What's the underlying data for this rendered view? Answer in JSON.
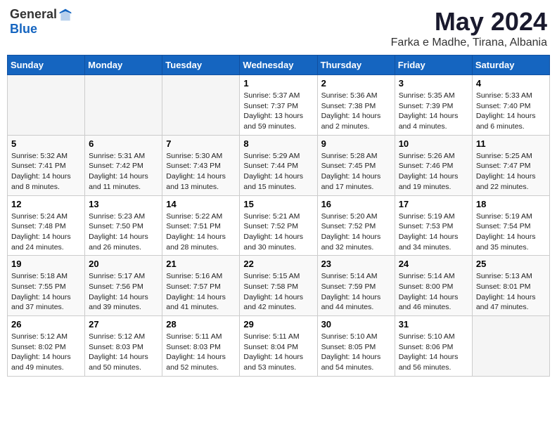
{
  "header": {
    "logo_general": "General",
    "logo_blue": "Blue",
    "title": "May 2024",
    "subtitle": "Farka e Madhe, Tirana, Albania"
  },
  "weekdays": [
    "Sunday",
    "Monday",
    "Tuesday",
    "Wednesday",
    "Thursday",
    "Friday",
    "Saturday"
  ],
  "weeks": [
    [
      {
        "day": "",
        "info": ""
      },
      {
        "day": "",
        "info": ""
      },
      {
        "day": "",
        "info": ""
      },
      {
        "day": "1",
        "info": "Sunrise: 5:37 AM\nSunset: 7:37 PM\nDaylight: 13 hours\nand 59 minutes."
      },
      {
        "day": "2",
        "info": "Sunrise: 5:36 AM\nSunset: 7:38 PM\nDaylight: 14 hours\nand 2 minutes."
      },
      {
        "day": "3",
        "info": "Sunrise: 5:35 AM\nSunset: 7:39 PM\nDaylight: 14 hours\nand 4 minutes."
      },
      {
        "day": "4",
        "info": "Sunrise: 5:33 AM\nSunset: 7:40 PM\nDaylight: 14 hours\nand 6 minutes."
      }
    ],
    [
      {
        "day": "5",
        "info": "Sunrise: 5:32 AM\nSunset: 7:41 PM\nDaylight: 14 hours\nand 8 minutes."
      },
      {
        "day": "6",
        "info": "Sunrise: 5:31 AM\nSunset: 7:42 PM\nDaylight: 14 hours\nand 11 minutes."
      },
      {
        "day": "7",
        "info": "Sunrise: 5:30 AM\nSunset: 7:43 PM\nDaylight: 14 hours\nand 13 minutes."
      },
      {
        "day": "8",
        "info": "Sunrise: 5:29 AM\nSunset: 7:44 PM\nDaylight: 14 hours\nand 15 minutes."
      },
      {
        "day": "9",
        "info": "Sunrise: 5:28 AM\nSunset: 7:45 PM\nDaylight: 14 hours\nand 17 minutes."
      },
      {
        "day": "10",
        "info": "Sunrise: 5:26 AM\nSunset: 7:46 PM\nDaylight: 14 hours\nand 19 minutes."
      },
      {
        "day": "11",
        "info": "Sunrise: 5:25 AM\nSunset: 7:47 PM\nDaylight: 14 hours\nand 22 minutes."
      }
    ],
    [
      {
        "day": "12",
        "info": "Sunrise: 5:24 AM\nSunset: 7:48 PM\nDaylight: 14 hours\nand 24 minutes."
      },
      {
        "day": "13",
        "info": "Sunrise: 5:23 AM\nSunset: 7:50 PM\nDaylight: 14 hours\nand 26 minutes."
      },
      {
        "day": "14",
        "info": "Sunrise: 5:22 AM\nSunset: 7:51 PM\nDaylight: 14 hours\nand 28 minutes."
      },
      {
        "day": "15",
        "info": "Sunrise: 5:21 AM\nSunset: 7:52 PM\nDaylight: 14 hours\nand 30 minutes."
      },
      {
        "day": "16",
        "info": "Sunrise: 5:20 AM\nSunset: 7:52 PM\nDaylight: 14 hours\nand 32 minutes."
      },
      {
        "day": "17",
        "info": "Sunrise: 5:19 AM\nSunset: 7:53 PM\nDaylight: 14 hours\nand 34 minutes."
      },
      {
        "day": "18",
        "info": "Sunrise: 5:19 AM\nSunset: 7:54 PM\nDaylight: 14 hours\nand 35 minutes."
      }
    ],
    [
      {
        "day": "19",
        "info": "Sunrise: 5:18 AM\nSunset: 7:55 PM\nDaylight: 14 hours\nand 37 minutes."
      },
      {
        "day": "20",
        "info": "Sunrise: 5:17 AM\nSunset: 7:56 PM\nDaylight: 14 hours\nand 39 minutes."
      },
      {
        "day": "21",
        "info": "Sunrise: 5:16 AM\nSunset: 7:57 PM\nDaylight: 14 hours\nand 41 minutes."
      },
      {
        "day": "22",
        "info": "Sunrise: 5:15 AM\nSunset: 7:58 PM\nDaylight: 14 hours\nand 42 minutes."
      },
      {
        "day": "23",
        "info": "Sunrise: 5:14 AM\nSunset: 7:59 PM\nDaylight: 14 hours\nand 44 minutes."
      },
      {
        "day": "24",
        "info": "Sunrise: 5:14 AM\nSunset: 8:00 PM\nDaylight: 14 hours\nand 46 minutes."
      },
      {
        "day": "25",
        "info": "Sunrise: 5:13 AM\nSunset: 8:01 PM\nDaylight: 14 hours\nand 47 minutes."
      }
    ],
    [
      {
        "day": "26",
        "info": "Sunrise: 5:12 AM\nSunset: 8:02 PM\nDaylight: 14 hours\nand 49 minutes."
      },
      {
        "day": "27",
        "info": "Sunrise: 5:12 AM\nSunset: 8:03 PM\nDaylight: 14 hours\nand 50 minutes."
      },
      {
        "day": "28",
        "info": "Sunrise: 5:11 AM\nSunset: 8:03 PM\nDaylight: 14 hours\nand 52 minutes."
      },
      {
        "day": "29",
        "info": "Sunrise: 5:11 AM\nSunset: 8:04 PM\nDaylight: 14 hours\nand 53 minutes."
      },
      {
        "day": "30",
        "info": "Sunrise: 5:10 AM\nSunset: 8:05 PM\nDaylight: 14 hours\nand 54 minutes."
      },
      {
        "day": "31",
        "info": "Sunrise: 5:10 AM\nSunset: 8:06 PM\nDaylight: 14 hours\nand 56 minutes."
      },
      {
        "day": "",
        "info": ""
      }
    ]
  ]
}
